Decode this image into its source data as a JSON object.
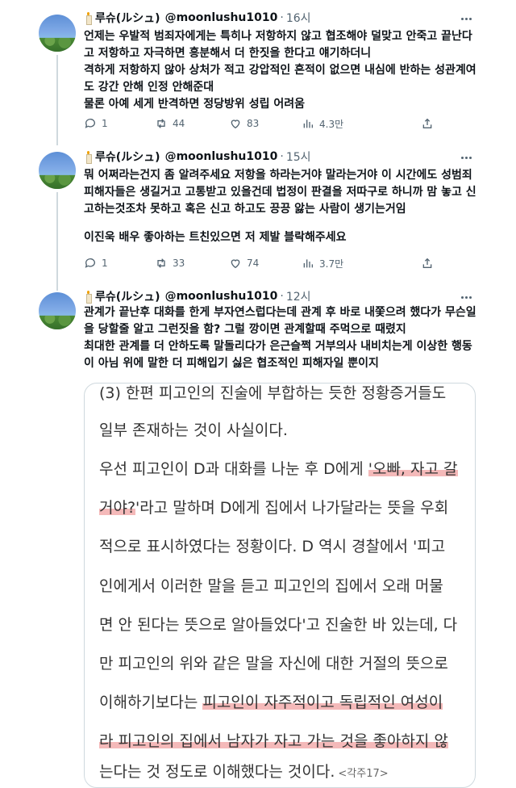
{
  "tweets": [
    {
      "name": "루슈(ルシュ)",
      "handle": "@moonlushu1010",
      "dot": "·",
      "time": "16시",
      "lines": [
        "언제는 우발적 범죄자에게는 특히나 저항하지 않고 협조해야 덜맞고 안죽고 끝난다",
        "고 저항하고 자극하면 흥분해서 더 한짓을 한다고 얘기하더니",
        "격하게 저항하지 않아 상처가 적고 강압적인 흔적이 없으면 내심에 반하는 성관계여",
        "도 강간 안해 인정 안해준대",
        "물론 아예 세게 반격하면 정당방위 성립 어려움"
      ],
      "replies": "1",
      "retweets": "44",
      "likes": "83",
      "views": "4.3만"
    },
    {
      "name": "루슈(ルシュ)",
      "handle": "@moonlushu1010",
      "dot": "·",
      "time": "15시",
      "lines": [
        "뭐 어쩌라는건지 좀 알려주세요 저항을 하라는거야 말라는거야 이 시간에도 성범죄",
        "피해자들은 생길거고 고통받고 있을건데 법정이 판결을 저따구로 하니까 맘 놓고 신",
        "고하는것조차 못하고 혹은 신고 하고도 끙끙 앓는 사람이 생기는거임",
        "",
        "이진욱 배우 좋아하는 트친있으면 저 제발 블락해주세요"
      ],
      "replies": "1",
      "retweets": "33",
      "likes": "74",
      "views": "3.7만"
    },
    {
      "name": "루슈(ルシュ)",
      "handle": "@moonlushu1010",
      "dot": "·",
      "time": "12시",
      "lines": [
        "관계가 끝난후 대화를 한게 부자연스럽다는데 관계 후 바로 내쫓으려 했다가 무슨일",
        "을 당할줄 알고 그런짓을 함? 그럴 깡이면 관계할때 주먹으로 때렸지",
        "최대한 관계를 더 안하도록 말돌리다가 은근슬쩍 거부의사 내비치는게 이상한 행동",
        "이 아님 위에 말한 더 피해입기 싫은 협조적인 피해자일 뿐이지"
      ]
    }
  ],
  "document": {
    "l1": "(3) 한편 피고인의 진술에 부합하는 듯한 정황증거들도",
    "l2": "일부 존재하는 것이 사실이다.",
    "l3a": "우선 피고인이 D과 대화를 나눈 후 D에게 ",
    "l3b": "'오빠, 자고 갈",
    "l4a": "거야?",
    "l4b": "'라고 말하며 D에게 집에서 나가달라는 뜻을 우회",
    "l5": "적으로 표시하였다는 정황이다. D 역시 경찰에서 '피고",
    "l6": "인에게서 이러한 말을 듣고 피고인의 집에서 오래 머물",
    "l7": "면 안 된다는 뜻으로 알아들었다'고 진술한 바 있는데, 다",
    "l8": "만 피고인의 위와 같은 말을 자신에 대한 거절의 뜻으로",
    "l9a": "이해하기보다는 ",
    "l9b": "피고인이 자주적이고 독립적인 여성이",
    "l10a": "라 피고인의 집에서 남자가 자고 가는 것을 좋아하지 않",
    "l11a": "는다는 것 정도로 이해했다는 것이다.",
    "l11b": "<각주17>"
  },
  "icons": {
    "reply": "comment-icon",
    "retweet": "retweet-icon",
    "like": "heart-icon",
    "views": "views-icon",
    "share": "share-icon",
    "more": "more-icon"
  },
  "colors": {
    "highlight": "#ec8080",
    "muted": "#536471",
    "text": "#0f1419"
  }
}
